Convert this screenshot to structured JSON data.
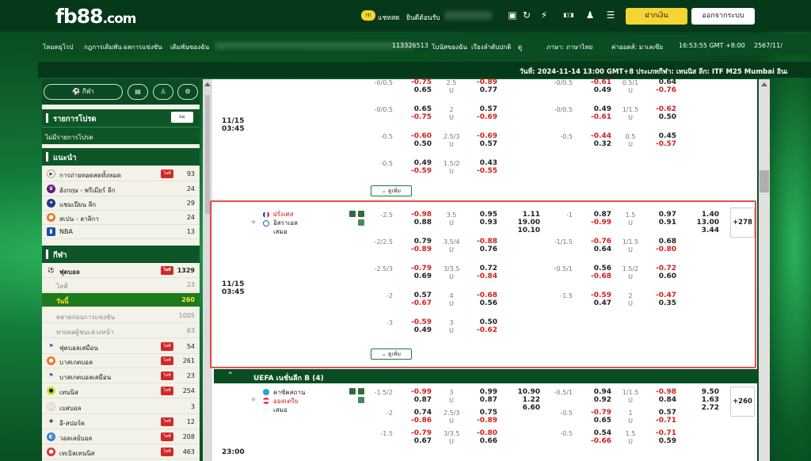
{
  "header": {
    "logo_main": "fb88",
    "logo_suffix": ".com",
    "chat_badge": "Hi",
    "chat_label": "แชทสด",
    "welcome": "ยินดีต้อนรับ",
    "deposit_button": "ฝากเงิน",
    "logout_button": "ออกจากระบบ"
  },
  "topbar": {
    "links": [
      "โหมดยุโรป",
      "กฎการเดิมพัน",
      "ผลการแข่งขัน",
      "เดิมพันของฉัน"
    ],
    "account_no": "113326513",
    "my_bets": "โบนัสของฉัน",
    "sort": "เรียงลำดับปกติ",
    "odds_type": "ดู",
    "language": "ภาษา: ภาษาไทย",
    "odds_format": "ค่าออดส์: มาเลเซีย",
    "time": "16:53:55 GMT +8:00",
    "date": "2567/11/"
  },
  "announcement": "วันที่: 2024-11-14 13:00 GMT+8 ประเภทกีฬา: เทนนิส ลีก: ITF M25 Mumbai อินเ",
  "sidebar": {
    "sports_pill": "กีฬา",
    "my_fav_title": "รายการโปรด",
    "my_fav_btn": "ผม",
    "no_fav": "ไม่มีรายการโปรด",
    "recommend_title": "แนะนำ",
    "recommend": [
      {
        "label": "การถ่ายทอดสดทั้งหมด",
        "count": "93",
        "live": "ไลฟ์"
      },
      {
        "label": "อังกฤษ - พรีเมียร์ ลีก",
        "count": "24"
      },
      {
        "label": "แชมเปียน ลีก",
        "count": "29"
      },
      {
        "label": "สเปน - ลาลีกา",
        "count": "24"
      },
      {
        "label": "NBA",
        "count": "13"
      }
    ],
    "sports_title": "กีฬา",
    "football": {
      "label": "ฟุตบอล",
      "count": "1329",
      "live": "ไลฟ์"
    },
    "football_sub": [
      {
        "label": "ไลฟ์",
        "count": "23"
      },
      {
        "label": "วันนี้",
        "count": "260"
      },
      {
        "label": "ตลาดก่อนการแข่งขัน",
        "count": "1005"
      },
      {
        "label": "ทายผลผู้ชนะล่วงหน้า",
        "count": "63"
      }
    ],
    "sports": [
      {
        "label": "ฟุตบอลเสมือน",
        "count": "54",
        "live": "ไลฟ์"
      },
      {
        "label": "บาสเกตบอล",
        "count": "261",
        "live": "ไลฟ์"
      },
      {
        "label": "บาสเกตบอลเสมือน",
        "count": "23",
        "live": "ไลฟ์"
      },
      {
        "label": "เทนนิส",
        "count": "254",
        "live": "ไลฟ์"
      },
      {
        "label": "เบสบอล",
        "count": "3"
      },
      {
        "label": "อี-สปอร์ต",
        "count": "12",
        "live": "ไลฟ์"
      },
      {
        "label": "วอลเลย์บอล",
        "count": "208",
        "live": "ไลฟ์"
      },
      {
        "label": "เทเบิลเทนนิส",
        "count": "463",
        "live": "ไลฟ์"
      }
    ]
  },
  "main": {
    "more_label": "ดูเพิ่ม",
    "match_top_time": [
      "11/15",
      "03:45"
    ],
    "top_rows": [
      {
        "h1": "-0/0.5",
        "a": "-0.75",
        "b": "0.65",
        "ou": "2.5",
        "u": "U",
        "c": "-0.89",
        "d": "0.77",
        "h2": "-0/0.5",
        "e": "-0.61",
        "f": "0.49",
        "ou2": "0.5/1",
        "u2": "U",
        "g": "0.64",
        "h": "-0.76"
      },
      {
        "h1": "-0/0.5",
        "a": "0.65",
        "b": "-0.75",
        "ou": "2",
        "u": "U",
        "c": "0.57",
        "d": "-0.69",
        "h2": "-0/0.5",
        "e": "0.49",
        "f": "-0.61",
        "ou2": "1/1.5",
        "u2": "U",
        "g": "-0.62",
        "h": "0.50"
      },
      {
        "h1": "-0.5",
        "a": "-0.60",
        "b": "0.50",
        "ou": "2.5/3",
        "u": "U",
        "c": "-0.69",
        "d": "0.57",
        "h2": "-0.5",
        "e": "-0.44",
        "f": "0.32",
        "ou2": "0.5",
        "u2": "U",
        "g": "0.45",
        "h": "-0.57"
      },
      {
        "h1": "-0.5",
        "a": "0.49",
        "b": "-0.59",
        "ou": "1.5/2",
        "u": "U",
        "c": "0.43",
        "d": "-0.55"
      }
    ],
    "match1": {
      "time": [
        "11/15",
        "03:45"
      ],
      "home": "ฝรั่งเศส",
      "away": "อิสราเอล",
      "draw": "เสมอ",
      "plus": "+278",
      "x12": [
        "1.11",
        "19.00",
        "10.10"
      ],
      "x12_h": [
        "1.40",
        "13.00",
        "3.44"
      ],
      "rows": [
        {
          "h1": "-2.5",
          "a": "-0.98",
          "b": "0.88",
          "ou": "3.5",
          "u": "U",
          "c": "0.95",
          "d": "0.93",
          "h2": "-1",
          "e": "0.87",
          "f": "-0.99",
          "ou2": "1.5",
          "u2": "U",
          "g": "0.97",
          "h": "0.91"
        },
        {
          "h1": "-2/2.5",
          "a": "0.79",
          "b": "-0.89",
          "ou": "3.5/4",
          "u": "U",
          "c": "-0.88",
          "d": "0.76",
          "h2": "-1/1.5",
          "e": "-0.76",
          "f": "0.64",
          "ou2": "1/1.5",
          "u2": "U",
          "g": "0.68",
          "h": "-0.80"
        },
        {
          "h1": "-2.5/3",
          "a": "-0.79",
          "b": "0.69",
          "ou": "3/3.5",
          "u": "U",
          "c": "0.72",
          "d": "-0.84",
          "h2": "-0.5/1",
          "e": "0.56",
          "f": "-0.68",
          "ou2": "1.5/2",
          "u2": "U",
          "g": "-0.72",
          "h": "0.60"
        },
        {
          "h1": "-2",
          "a": "0.57",
          "b": "-0.67",
          "ou": "4",
          "u": "U",
          "c": "-0.68",
          "d": "0.56",
          "h2": "-1.5",
          "e": "-0.59",
          "f": "0.47",
          "ou2": "2",
          "u2": "U",
          "g": "-0.47",
          "h": "0.35"
        },
        {
          "h1": "-3",
          "a": "-0.59",
          "b": "0.49",
          "ou": "3",
          "u": "U",
          "c": "0.50",
          "d": "-0.62"
        }
      ]
    },
    "league2": "UEFA เนชั่นลีก B (4)",
    "match2": {
      "home": "คาซัคสถาน",
      "away": "ออสเตรีย",
      "draw": "เสมอ",
      "plus": "+260",
      "x12": [
        "10.90",
        "1.22",
        "6.60"
      ],
      "x12_h": [
        "9.50",
        "1.63",
        "2.72"
      ],
      "rows": [
        {
          "h1": "-1.5/2",
          "a": "-0.99",
          "b": "0.87",
          "ou": "3",
          "u": "U",
          "c": "0.99",
          "d": "0.87",
          "h2": "-0.5/1",
          "e": "0.94",
          "f": "0.92",
          "ou2": "1/1.5",
          "u2": "U",
          "g": "-0.98",
          "h": "0.84"
        },
        {
          "h1": "-2",
          "a": "0.74",
          "b": "-0.86",
          "ou": "2.5/3",
          "u": "U",
          "c": "0.75",
          "d": "-0.89",
          "h2": "-0.5",
          "e": "-0.79",
          "f": "0.65",
          "ou2": "1",
          "u2": "U",
          "g": "0.57",
          "h": "-0.71"
        },
        {
          "h1": "-1.5",
          "a": "-0.79",
          "b": "0.67",
          "ou": "3/3.5",
          "u": "U",
          "c": "-0.80",
          "d": "0.66",
          "h2": "-0.5",
          "e": "0.54",
          "f": "-0.66",
          "ou2": "1.5",
          "u2": "U",
          "g": "-0.71",
          "h": "0.59"
        }
      ]
    },
    "next_time": "23:00"
  },
  "colors": {
    "brand_green": "#0a4d22",
    "negative_red": "#d81c1c",
    "deposit_yellow": "#f5d533",
    "live_red": "#cf2a2a"
  }
}
